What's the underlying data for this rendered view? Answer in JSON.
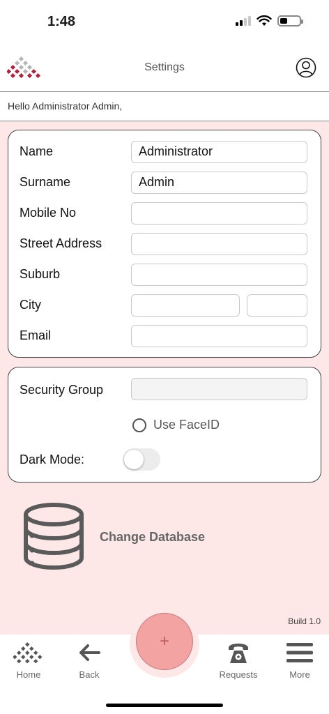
{
  "status_bar": {
    "time": "1:48"
  },
  "nav": {
    "title": "Settings"
  },
  "greeting": "Hello Administrator Admin,",
  "profile": {
    "name_label": "Name",
    "name_value": "Administrator",
    "surname_label": "Surname",
    "surname_value": "Admin",
    "mobile_label": "Mobile No",
    "mobile_value": "",
    "street_label": "Street Address",
    "street_value": "",
    "suburb_label": "Suburb",
    "suburb_value": "",
    "city_label": "City",
    "city_value": "",
    "postcode_value": "",
    "email_label": "Email",
    "email_value": ""
  },
  "security": {
    "group_label": "Security Group",
    "group_value": "",
    "faceid_label": "Use FaceID",
    "faceid_selected": false,
    "dark_mode_label": "Dark Mode:",
    "dark_mode_on": false
  },
  "database": {
    "label": "Change Database",
    "icon": "database-icon"
  },
  "build": "Build 1.0",
  "tabbar": {
    "home": "Home",
    "back": "Back",
    "add": "+",
    "requests": "Requests",
    "more": "More"
  },
  "colors": {
    "background": "#fde7e7",
    "fab": "#f4a3a3",
    "logo_red": "#b0213c",
    "logo_grey": "#b5b5b5"
  }
}
